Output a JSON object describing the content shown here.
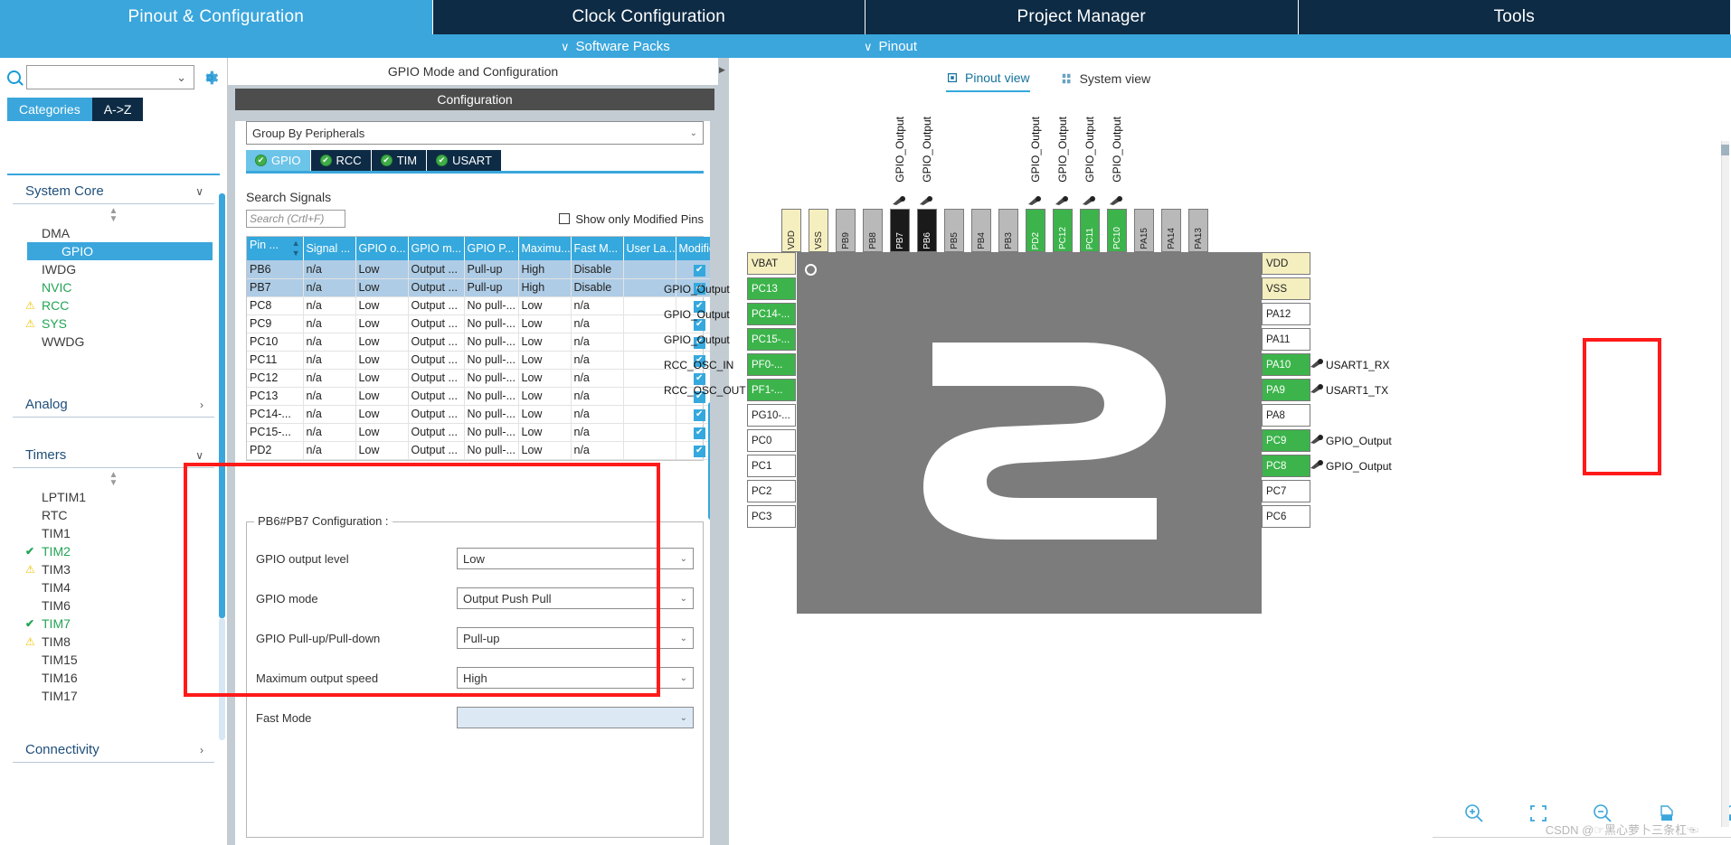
{
  "top_tabs": [
    {
      "label": "Pinout & Configuration",
      "active": true
    },
    {
      "label": "Clock Configuration",
      "active": false
    },
    {
      "label": "Project Manager",
      "active": false
    },
    {
      "label": "Tools",
      "active": false
    }
  ],
  "subbar": {
    "software_packs": "Software Packs",
    "pinout": "Pinout",
    "chevron": "∨"
  },
  "left": {
    "search_value": "",
    "search_icon": "search-icon",
    "gear_icon": "gear-icon",
    "tabs": [
      {
        "label": "Categories",
        "active": true
      },
      {
        "label": "A->Z",
        "active": false
      }
    ],
    "groups": [
      {
        "name": "System Core",
        "expanded": true,
        "arrow": "∨",
        "items": [
          {
            "label": "DMA",
            "state": "none",
            "selected": false
          },
          {
            "label": "GPIO",
            "state": "none",
            "selected": true
          },
          {
            "label": "IWDG",
            "state": "none",
            "selected": false
          },
          {
            "label": "NVIC",
            "state": "ok-text",
            "selected": false
          },
          {
            "label": "RCC",
            "state": "warn",
            "selected": false
          },
          {
            "label": "SYS",
            "state": "warn",
            "selected": false
          },
          {
            "label": "WWDG",
            "state": "none",
            "selected": false
          }
        ]
      },
      {
        "name": "Analog",
        "expanded": false,
        "arrow": "›",
        "items": []
      },
      {
        "name": "Timers",
        "expanded": true,
        "arrow": "∨",
        "items": [
          {
            "label": "LPTIM1",
            "state": "none",
            "selected": false
          },
          {
            "label": "RTC",
            "state": "none",
            "selected": false
          },
          {
            "label": "TIM1",
            "state": "none",
            "selected": false
          },
          {
            "label": "TIM2",
            "state": "check",
            "selected": false
          },
          {
            "label": "TIM3",
            "state": "warn",
            "selected": false
          },
          {
            "label": "TIM4",
            "state": "none",
            "selected": false
          },
          {
            "label": "TIM6",
            "state": "none",
            "selected": false
          },
          {
            "label": "TIM7",
            "state": "check",
            "selected": false
          },
          {
            "label": "TIM8",
            "state": "warn",
            "selected": false
          },
          {
            "label": "TIM15",
            "state": "none",
            "selected": false
          },
          {
            "label": "TIM16",
            "state": "none",
            "selected": false
          },
          {
            "label": "TIM17",
            "state": "none",
            "selected": false
          }
        ]
      },
      {
        "name": "Connectivity",
        "expanded": false,
        "arrow": "›",
        "items": []
      }
    ]
  },
  "center": {
    "mode_title": "GPIO Mode and Configuration",
    "configuration_band": "Configuration",
    "group_by": "Group By Peripherals",
    "group_by_caret": "⌄",
    "peripheral_tabs": [
      {
        "label": "GPIO",
        "active": true
      },
      {
        "label": "RCC",
        "active": false
      },
      {
        "label": "TIM",
        "active": false
      },
      {
        "label": "USART",
        "active": false
      }
    ],
    "search_signals_label": "Search Signals",
    "search_signals_placeholder": "Search (Crtl+F)",
    "show_modified_pins": "Show only Modified Pins",
    "show_modified_checked": false,
    "table": {
      "columns": [
        "Pin ...",
        "Signal ...",
        "GPIO o...",
        "GPIO m...",
        "GPIO P...",
        "Maximu...",
        "Fast M...",
        "User La...",
        "Modified"
      ],
      "sort_column": "Pin ...",
      "rows": [
        {
          "cells": [
            "PB6",
            "n/a",
            "Low",
            "Output ...",
            "Pull-up",
            "High",
            "Disable",
            ""
          ],
          "modified": true,
          "highlight": true
        },
        {
          "cells": [
            "PB7",
            "n/a",
            "Low",
            "Output ...",
            "Pull-up",
            "High",
            "Disable",
            ""
          ],
          "modified": true,
          "highlight": true
        },
        {
          "cells": [
            "PC8",
            "n/a",
            "Low",
            "Output ...",
            "No pull-...",
            "Low",
            "n/a",
            ""
          ],
          "modified": true,
          "highlight": false
        },
        {
          "cells": [
            "PC9",
            "n/a",
            "Low",
            "Output ...",
            "No pull-...",
            "Low",
            "n/a",
            ""
          ],
          "modified": true,
          "highlight": false
        },
        {
          "cells": [
            "PC10",
            "n/a",
            "Low",
            "Output ...",
            "No pull-...",
            "Low",
            "n/a",
            ""
          ],
          "modified": true,
          "highlight": false
        },
        {
          "cells": [
            "PC11",
            "n/a",
            "Low",
            "Output ...",
            "No pull-...",
            "Low",
            "n/a",
            ""
          ],
          "modified": true,
          "highlight": false
        },
        {
          "cells": [
            "PC12",
            "n/a",
            "Low",
            "Output ...",
            "No pull-...",
            "Low",
            "n/a",
            ""
          ],
          "modified": true,
          "highlight": false
        },
        {
          "cells": [
            "PC13",
            "n/a",
            "Low",
            "Output ...",
            "No pull-...",
            "Low",
            "n/a",
            ""
          ],
          "modified": true,
          "highlight": false
        },
        {
          "cells": [
            "PC14-...",
            "n/a",
            "Low",
            "Output ...",
            "No pull-...",
            "Low",
            "n/a",
            ""
          ],
          "modified": true,
          "highlight": false
        },
        {
          "cells": [
            "PC15-...",
            "n/a",
            "Low",
            "Output ...",
            "No pull-...",
            "Low",
            "n/a",
            ""
          ],
          "modified": true,
          "highlight": false
        },
        {
          "cells": [
            "PD2",
            "n/a",
            "Low",
            "Output ...",
            "No pull-...",
            "Low",
            "n/a",
            ""
          ],
          "modified": true,
          "highlight": false
        }
      ]
    },
    "config_group": {
      "legend": "PB6#PB7 Configuration :",
      "fields": [
        {
          "label": "GPIO output level",
          "value": "Low",
          "disabled": false
        },
        {
          "label": "GPIO mode",
          "value": "Output Push Pull",
          "disabled": false
        },
        {
          "label": "GPIO Pull-up/Pull-down",
          "value": "Pull-up",
          "disabled": false
        },
        {
          "label": "Maximum output speed",
          "value": "High",
          "disabled": false
        },
        {
          "label": "Fast Mode",
          "value": "",
          "disabled": true
        }
      ]
    }
  },
  "right": {
    "view_tabs": [
      {
        "label": "Pinout view",
        "active": true,
        "icon": "chip-icon"
      },
      {
        "label": "System view",
        "active": false,
        "icon": "grid-icon"
      }
    ],
    "top_pins": [
      {
        "name": "VDD",
        "color": "yellow",
        "signal": ""
      },
      {
        "name": "VSS",
        "color": "yellow",
        "signal": ""
      },
      {
        "name": "PB9",
        "color": "gray",
        "signal": ""
      },
      {
        "name": "PB8",
        "color": "gray",
        "signal": ""
      },
      {
        "name": "PB7",
        "color": "dark",
        "signal": "GPIO_Output"
      },
      {
        "name": "PB6",
        "color": "dark",
        "signal": "GPIO_Output"
      },
      {
        "name": "PB5",
        "color": "gray",
        "signal": ""
      },
      {
        "name": "PB4",
        "color": "gray",
        "signal": ""
      },
      {
        "name": "PB3",
        "color": "gray",
        "signal": ""
      },
      {
        "name": "PD2",
        "color": "green",
        "signal": "GPIO_Output"
      },
      {
        "name": "PC12",
        "color": "green",
        "signal": "GPIO_Output"
      },
      {
        "name": "PC11",
        "color": "green",
        "signal": "GPIO_Output"
      },
      {
        "name": "PC10",
        "color": "green",
        "signal": "GPIO_Output"
      },
      {
        "name": "PA15",
        "color": "gray",
        "signal": ""
      },
      {
        "name": "PA14",
        "color": "gray",
        "signal": ""
      },
      {
        "name": "PA13",
        "color": "gray",
        "signal": ""
      }
    ],
    "left_pins": [
      {
        "name": "VBAT",
        "color": "yellow",
        "signal": ""
      },
      {
        "name": "PC13",
        "color": "green",
        "signal": "GPIO_Output"
      },
      {
        "name": "PC14-...",
        "color": "green",
        "signal": "GPIO_Output"
      },
      {
        "name": "PC15-...",
        "color": "green",
        "signal": "GPIO_Output"
      },
      {
        "name": "PF0-...",
        "color": "green",
        "signal": "RCC_OSC_IN"
      },
      {
        "name": "PF1-...",
        "color": "green",
        "signal": "RCC_OSC_OUT"
      },
      {
        "name": "PG10-...",
        "color": "white",
        "signal": ""
      },
      {
        "name": "PC0",
        "color": "white",
        "signal": ""
      },
      {
        "name": "PC1",
        "color": "white",
        "signal": ""
      },
      {
        "name": "PC2",
        "color": "white",
        "signal": ""
      },
      {
        "name": "PC3",
        "color": "white",
        "signal": ""
      }
    ],
    "right_pins": [
      {
        "name": "VDD",
        "color": "yellow",
        "signal": ""
      },
      {
        "name": "VSS",
        "color": "yellow",
        "signal": ""
      },
      {
        "name": "PA12",
        "color": "white",
        "signal": ""
      },
      {
        "name": "PA11",
        "color": "white",
        "signal": ""
      },
      {
        "name": "PA10",
        "color": "green",
        "signal": "USART1_RX"
      },
      {
        "name": "PA9",
        "color": "green",
        "signal": "USART1_TX"
      },
      {
        "name": "PA8",
        "color": "white",
        "signal": ""
      },
      {
        "name": "PC9",
        "color": "green",
        "signal": "GPIO_Output"
      },
      {
        "name": "PC8",
        "color": "green",
        "signal": "GPIO_Output"
      },
      {
        "name": "PC7",
        "color": "white",
        "signal": ""
      },
      {
        "name": "PC6",
        "color": "white",
        "signal": ""
      }
    ],
    "toolbar": [
      {
        "icon": "zoom-in-icon",
        "name": "zoom-in"
      },
      {
        "icon": "fit-icon",
        "name": "fit-to-screen"
      },
      {
        "icon": "zoom-out-icon",
        "name": "zoom-out"
      },
      {
        "icon": "rotate-right-icon",
        "name": "rotate-right"
      },
      {
        "icon": "rotate-left-icon",
        "name": "rotate-left"
      },
      {
        "icon": "flip-horizontal-icon",
        "name": "flip-horizontal"
      },
      {
        "icon": "flip-vertical-icon",
        "name": "flip-vertical"
      },
      {
        "icon": "search-icon",
        "name": "pin-search"
      }
    ],
    "zoom_select_value": ""
  },
  "watermark": "CSDN @☞黑心萝卜三条杠☜"
}
